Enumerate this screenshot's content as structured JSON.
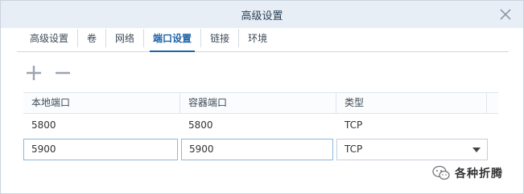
{
  "window": {
    "title": "高级设置"
  },
  "tabs": [
    {
      "label": "高级设置"
    },
    {
      "label": "卷"
    },
    {
      "label": "网络"
    },
    {
      "label": "端口设置",
      "active": true
    },
    {
      "label": "链接"
    },
    {
      "label": "环境"
    }
  ],
  "toolbar": {
    "add_icon": "plus-icon",
    "remove_icon": "minus-icon"
  },
  "table": {
    "headers": {
      "local_port": "本地端口",
      "container_port": "容器端口",
      "type": "类型"
    },
    "rows": [
      {
        "local_port": "5800",
        "container_port": "5800",
        "type": "TCP"
      }
    ],
    "edit_row": {
      "local_port": "5900",
      "container_port": "5900",
      "type": "TCP"
    }
  },
  "watermark": {
    "text": "各种折腾"
  },
  "colors": {
    "accent": "#1e63a6",
    "titlebar": "#e8eef5",
    "input_border": "#8fb6d9"
  }
}
